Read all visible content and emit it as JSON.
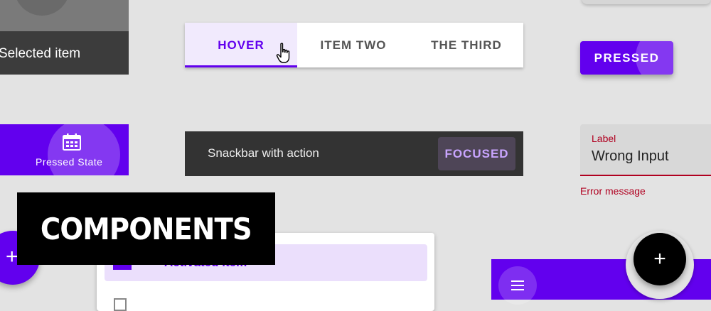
{
  "selected_tile": {
    "label": "Selected item"
  },
  "tabs": {
    "items": [
      {
        "label": "HOVER"
      },
      {
        "label": "ITEM TWO"
      },
      {
        "label": "THE THIRD"
      }
    ]
  },
  "pressed_button": {
    "label": "PRESSED"
  },
  "bottom_nav": {
    "label": "Pressed State",
    "icon": "calendar-icon"
  },
  "snackbar": {
    "message": "Snackbar with action",
    "action": "FOCUSED"
  },
  "text_field": {
    "label": "Label",
    "value": "Wrong Input",
    "error": "Error message"
  },
  "banner": {
    "text": "COMPONENTS"
  },
  "menu": {
    "activated_item": "Activated item"
  },
  "fab": {
    "left_icon": "+",
    "right_icon": "+"
  },
  "colors": {
    "primary": "#6200ee",
    "error": "#b00020",
    "surface": "#ffffff",
    "snackbar": "#333333"
  }
}
